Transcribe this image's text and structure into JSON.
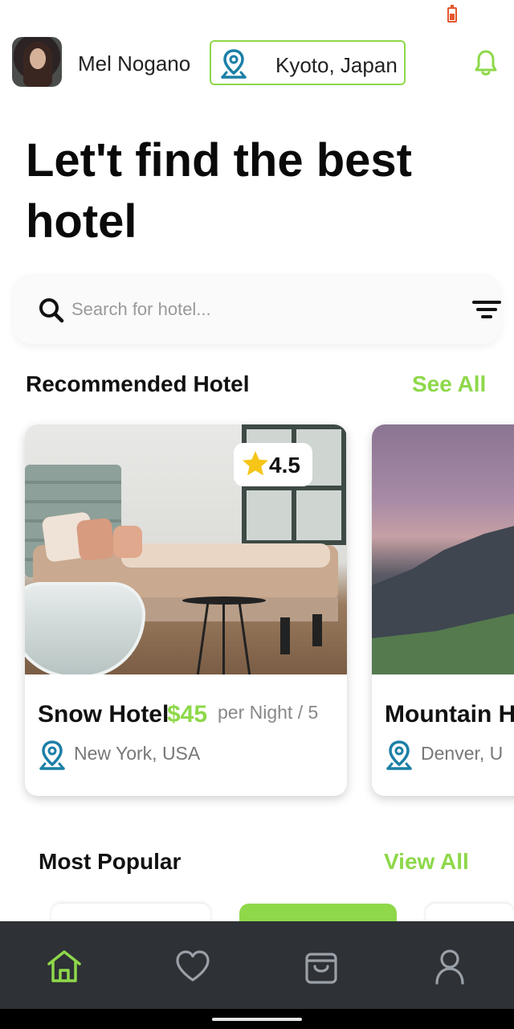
{
  "user": {
    "name": "Mel Nogano"
  },
  "location": {
    "label": "Kyoto, Japan"
  },
  "headline": "Let't find the best hotel",
  "search": {
    "placeholder": "Search for hotel..."
  },
  "recommended": {
    "title": "Recommended Hotel",
    "link": "See All",
    "cards": [
      {
        "name": "Snow Hotel",
        "price": "$45",
        "per_night": "per Night / 5",
        "location": "New York, USA",
        "rating": "4.5",
        "image": "bedroom"
      },
      {
        "name": "Mountain H",
        "location": "Denver, U",
        "image": "mountain"
      }
    ]
  },
  "popular": {
    "title": "Most Popular",
    "link": "View All"
  },
  "nav": [
    {
      "name": "Home",
      "icon": "home-icon",
      "active": true
    },
    {
      "name": "Favorites",
      "icon": "heart-icon",
      "active": false
    },
    {
      "name": "Bookings",
      "icon": "bag-icon",
      "active": false
    },
    {
      "name": "Profile",
      "icon": "user-icon",
      "active": false
    }
  ],
  "colors": {
    "accent": "#8ed84a",
    "pin": "#1b7fa6",
    "nav_bg": "#2e3136",
    "nav_icon": "#9aa0a8",
    "star": "#f5c518"
  }
}
